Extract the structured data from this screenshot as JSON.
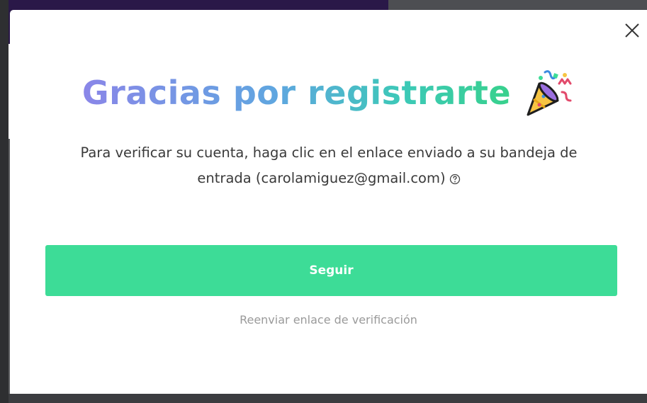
{
  "modal": {
    "title": "Gracias por registrarte",
    "title_icon": "party-popper-icon",
    "message_line1": "Para verificar su cuenta, haga clic en el enlace enviado a su bandeja de",
    "message_line2": "entrada (carolamiguez@gmail.com)",
    "help_icon": "question-circle-icon",
    "primary_button_label": "Seguir",
    "resend_link_label": "Reenviar enlace de verificación",
    "close_icon": "close-icon"
  },
  "colors": {
    "primary_button": "#3ddc97",
    "title_gradient_start": "#8a86e8",
    "title_gradient_end": "#38d18c",
    "body_text": "#3a3a3a",
    "muted_link": "#9a9a9a"
  }
}
